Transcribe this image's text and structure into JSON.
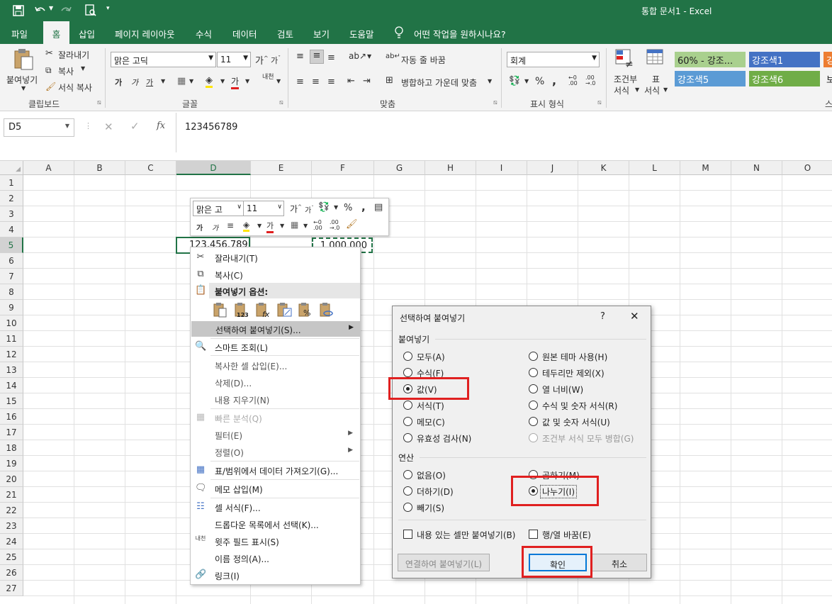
{
  "titlebar": {
    "doc_title": "통합 문서1  -  Excel"
  },
  "menu": {
    "items": [
      "파일",
      "홈",
      "삽입",
      "페이지 레이아웃",
      "수식",
      "데이터",
      "검토",
      "보기",
      "도움말"
    ],
    "search": "어떤 작업을 원하시나요?"
  },
  "ribbon": {
    "clipboard": {
      "paste": "붙여넣기",
      "cut": "잘라내기",
      "copy": "복사",
      "format_painter": "서식 복사",
      "label": "클립보드"
    },
    "font": {
      "name": "맑은 고딕",
      "size": "11",
      "label": "글꼴"
    },
    "align": {
      "wrap": "자동 줄 바꿈",
      "merge": "병합하고 가운데 맞춤",
      "label": "맞춤"
    },
    "number": {
      "format": "회계",
      "label": "표시 형식"
    },
    "styles": {
      "conditional": "조건부",
      "conditional2": "서식",
      "table": "표",
      "table2": "서식",
      "s1": "60% - 강조...",
      "s2": "강조색1",
      "s3": "강조색5",
      "s4": "강조색6",
      "s5": "강",
      "s6": "보",
      "label": "스"
    }
  },
  "formula": {
    "name_box": "D5",
    "value": "123456789"
  },
  "sheet": {
    "columns": [
      "A",
      "B",
      "C",
      "D",
      "E",
      "F",
      "G",
      "H",
      "I",
      "J",
      "K",
      "L",
      "M",
      "N",
      "O"
    ],
    "rows": [
      "1",
      "2",
      "3",
      "4",
      "5",
      "6",
      "7",
      "8",
      "9",
      "10",
      "11",
      "12",
      "13",
      "14",
      "15",
      "16",
      "17",
      "18",
      "19",
      "20",
      "21",
      "22",
      "23",
      "24",
      "25",
      "26",
      "27"
    ],
    "d5": "123,456,789",
    "f5": "1,000,000"
  },
  "mini": {
    "font": "맑은 고",
    "size": "11"
  },
  "context_menu": {
    "cut": "잘라내기(T)",
    "copy": "복사(C)",
    "paste_options": "붙여넣기 옵션:",
    "paste_special": "선택하여 붙여넣기(S)...",
    "smart_lookup": "스마트 조회(L)",
    "insert_copied": "복사한 셀 삽입(E)...",
    "delete": "삭제(D)...",
    "clear": "내용 지우기(N)",
    "quick_analysis": "빠른 분석(Q)",
    "filter": "필터(E)",
    "sort": "정렬(O)",
    "get_data": "표/범위에서 데이터 가져오기(G)...",
    "insert_comment": "메모 삽입(M)",
    "format_cells": "셀 서식(F)...",
    "pick_list": "드롭다운 목록에서 선택(K)...",
    "phonetic": "윗주 필드 표시(S)",
    "define_name": "이름 정의(A)...",
    "link": "링크(I)"
  },
  "dialog": {
    "title": "선택하여 붙여넣기",
    "help": "?",
    "close": "✕",
    "paste_group": "붙여넣기",
    "paste_left": [
      "모두(A)",
      "수식(F)",
      "값(V)",
      "서식(T)",
      "메모(C)",
      "유효성 검사(N)"
    ],
    "paste_right": [
      "원본 테마 사용(H)",
      "테두리만 제외(X)",
      "열 너비(W)",
      "수식 및 숫자 서식(R)",
      "값 및 숫자 서식(U)",
      "조건부 서식 모두 병합(G)"
    ],
    "op_group": "연산",
    "op_left": [
      "없음(O)",
      "더하기(D)",
      "빼기(S)"
    ],
    "op_right": [
      "곱하기(M)",
      "나누기(I)"
    ],
    "skip_blanks": "내용 있는 셀만 붙여넣기(B)",
    "transpose": "행/열 바꿈(E)",
    "paste_link": "연결하여 붙여넣기(L)",
    "ok": "확인",
    "cancel": "취소"
  },
  "colors": {
    "excel_green": "#217346",
    "highlight_red": "#e02020"
  }
}
